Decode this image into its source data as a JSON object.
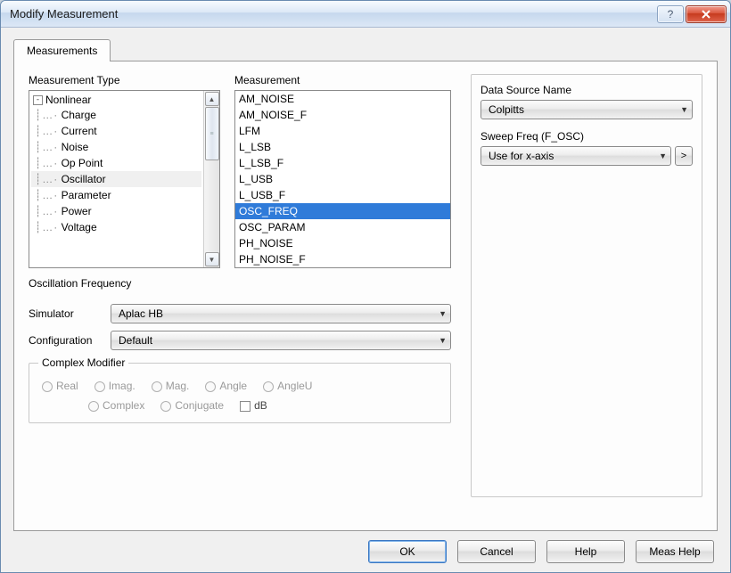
{
  "window": {
    "title": "Modify Measurement"
  },
  "tabs": {
    "active": "Measurements"
  },
  "tree": {
    "label": "Measurement Type",
    "root": "Nonlinear",
    "items": [
      "Charge",
      "Current",
      "Noise",
      "Op Point",
      "Oscillator",
      "Parameter",
      "Power",
      "Voltage"
    ],
    "selected": "Oscillator"
  },
  "list": {
    "label": "Measurement",
    "items": [
      "AM_NOISE",
      "AM_NOISE_F",
      "LFM",
      "L_LSB",
      "L_LSB_F",
      "L_USB",
      "L_USB_F",
      "OSC_FREQ",
      "OSC_PARAM",
      "PH_NOISE",
      "PH_NOISE_F"
    ],
    "selected": "OSC_FREQ"
  },
  "description": "Oscillation Frequency",
  "form": {
    "simulator_label": "Simulator",
    "simulator_value": "Aplac HB",
    "config_label": "Configuration",
    "config_value": "Default"
  },
  "complex": {
    "legend": "Complex Modifier",
    "row1": [
      "Real",
      "Imag.",
      "Mag.",
      "Angle",
      "AngleU"
    ],
    "row2": [
      "Complex",
      "Conjugate"
    ],
    "db": "dB"
  },
  "right": {
    "ds_label": "Data Source Name",
    "ds_value": "Colpitts",
    "sweep_label": "Sweep Freq (F_OSC)",
    "sweep_value": "Use for x-axis"
  },
  "buttons": {
    "ok": "OK",
    "cancel": "Cancel",
    "help": "Help",
    "meas_help": "Meas Help"
  }
}
